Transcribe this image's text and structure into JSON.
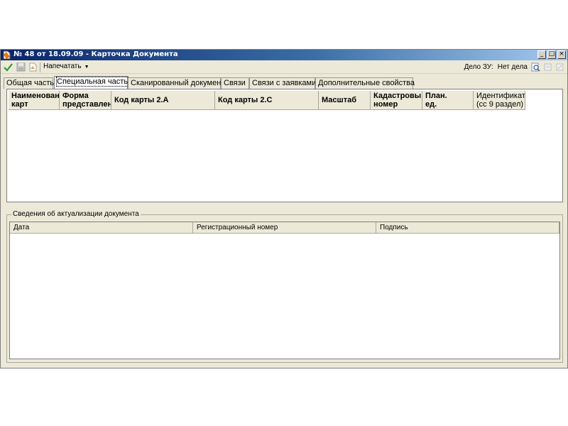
{
  "window": {
    "title": "№ 48 от 18.09.09 - Карточка Документа",
    "buttons": {
      "minimize": "_",
      "maximize": "□",
      "close": "×"
    }
  },
  "toolbar": {
    "icons": [
      "checkmark-icon",
      "save-icon",
      "document-icon"
    ],
    "print_label": "Напечатать",
    "delo_label": "Дело ЗУ:",
    "delo_value": "Нет дела",
    "right_icons": [
      "search-icon",
      "link-icon",
      "unlink-icon"
    ]
  },
  "tabs": [
    {
      "label": "Общая часть",
      "active": false
    },
    {
      "label": "Специальная часть",
      "active": true
    },
    {
      "label": "Сканированный документ",
      "active": false
    },
    {
      "label": "Связи",
      "active": false
    },
    {
      "label": "Связи с заявками",
      "active": false
    },
    {
      "label": "Дополнительные свойства",
      "active": false
    }
  ],
  "maps_table": {
    "columns": [
      {
        "line1": "Наименован",
        "line2": "карт",
        "bold": true
      },
      {
        "line1": "Форма",
        "line2": "представлен",
        "bold": true
      },
      {
        "line1": "Код карты 2.А",
        "line2": "",
        "bold": true
      },
      {
        "line1": "Код карты 2.С",
        "line2": "",
        "bold": true
      },
      {
        "line1": "Масштаб",
        "line2": "",
        "bold": true
      },
      {
        "line1": "Кадастровы",
        "line2": "номер",
        "bold": true
      },
      {
        "line1": "План.",
        "line2": "ед.",
        "bold": true
      },
      {
        "line1": "Идентификат",
        "line2": "(сс 9 раздел)",
        "bold": false
      }
    ],
    "rows": []
  },
  "updates_group": {
    "title": "Сведения об актуализации документа",
    "columns": [
      "Дата",
      "Регистрационный номер",
      "Подпись"
    ],
    "rows": []
  }
}
